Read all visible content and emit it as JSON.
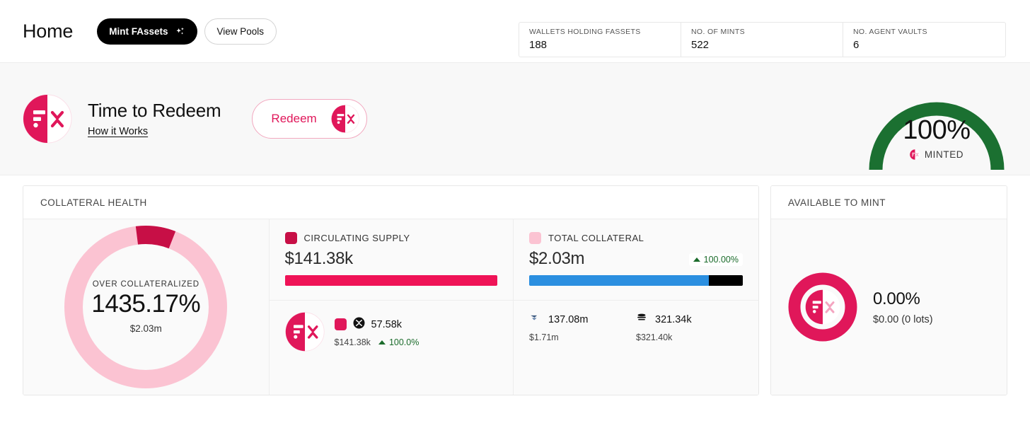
{
  "header": {
    "title": "Home",
    "mint_button": "Mint FAssets",
    "pools_button": "View Pools",
    "stats": [
      {
        "label": "WALLETS HOLDING FASSETS",
        "value": "188"
      },
      {
        "label": "NO. OF MINTS",
        "value": "522"
      },
      {
        "label": "NO. AGENT VAULTS",
        "value": "6"
      }
    ]
  },
  "banner": {
    "title": "Time to Redeem",
    "link": "How it Works",
    "redeem_button": "Redeem",
    "gauge": {
      "value": "100%",
      "sub_label": "MINTED",
      "percent": 100,
      "arc_color": "#1b7031"
    }
  },
  "collateral_card": {
    "title": "COLLATERAL HEALTH",
    "donut": {
      "label": "OVER COLLATERALIZED",
      "percent_text": "1435.17%",
      "usd": "$2.03m",
      "segment_percent": 8,
      "segment_color": "#c70f46",
      "track_color": "#fbc3d2"
    },
    "circulating_supply": {
      "legend": "CIRCULATING SUPPLY",
      "swatch_color": "#c70f46",
      "value": "$141.38k",
      "bar": [
        {
          "percent": 100,
          "color": "#ef1357"
        }
      ]
    },
    "total_collateral": {
      "legend": "TOTAL COLLATERAL",
      "swatch_color": "#fbc3d2",
      "value": "$2.03m",
      "delta": "100.00%",
      "bar": [
        {
          "percent": 84,
          "color": "#2b8fe0"
        },
        {
          "percent": 16,
          "color": "#000000"
        }
      ]
    },
    "supply_detail": {
      "token_icon": "xrp-icon",
      "swatch_color": "#e0175a",
      "token_amount": "57.58k",
      "usd": "$141.38k",
      "delta": "100.0%"
    },
    "collateral_assets": [
      {
        "icon": "flare-icon",
        "amount": "137.08m",
        "usd": "$1.71m"
      },
      {
        "icon": "usdx-stack-icon",
        "amount": "321.34k",
        "usd": "$321.40k"
      }
    ]
  },
  "mint_card": {
    "title": "AVAILABLE TO MINT",
    "percent_text": "0.00%",
    "usd": "$0.00 (0 lots)",
    "ring_percent": 0,
    "ring_color": "#e0175a"
  }
}
